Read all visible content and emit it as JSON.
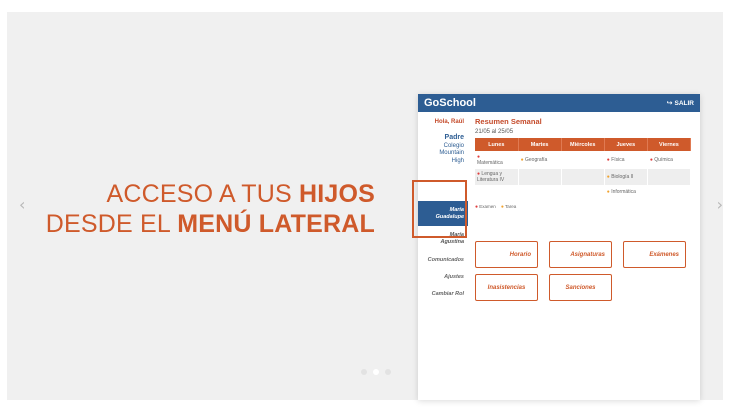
{
  "slider": {
    "prev_icon": "chevron-left-icon",
    "next_icon": "chevron-right-icon",
    "headline_line1_prefix": "ACCESO A TUS ",
    "headline_line1_bold": "HIJOS",
    "headline_line2_prefix": "DESDE EL ",
    "headline_line2_bold": "MENÚ LATERAL",
    "accent_color": "#cf5a2b",
    "dots": [
      {
        "active": false
      },
      {
        "active": true
      },
      {
        "active": false
      }
    ]
  },
  "app": {
    "logo": "GoSchool",
    "logout_label": "SALIR",
    "logout_icon": "logout-icon",
    "header_color": "#2d5d93",
    "sidebar": {
      "greeting": "Hola, Raúl",
      "role": "Padre",
      "school_lines": [
        "Colegio",
        "Mountain",
        "High"
      ],
      "children": [
        {
          "first": "María",
          "last": "Guadalupe",
          "selected": true
        },
        {
          "first": "María",
          "last": "Agustina",
          "selected": false
        }
      ],
      "links": [
        "Comunicados",
        "Ajustes",
        "Cambiar Rol"
      ]
    },
    "summary": {
      "title": "Resumen Semanal",
      "date_range": "21/05 al 25/05",
      "days": [
        "Lunes",
        "Martes",
        "Miércoles",
        "Jueves",
        "Viernes"
      ],
      "rows": [
        [
          "Matemática",
          "Geografía",
          "",
          "Física",
          "Química"
        ],
        [
          "Lengua y Literatura IV",
          "",
          "",
          "Biología II",
          ""
        ],
        [
          "",
          "",
          "",
          "Informática",
          ""
        ]
      ],
      "legend_exam": "Examen",
      "legend_task": "Tarea"
    },
    "cards": [
      "Horario",
      "Asignaturas",
      "Exámenes",
      "Inasistencias",
      "Sanciones"
    ]
  }
}
